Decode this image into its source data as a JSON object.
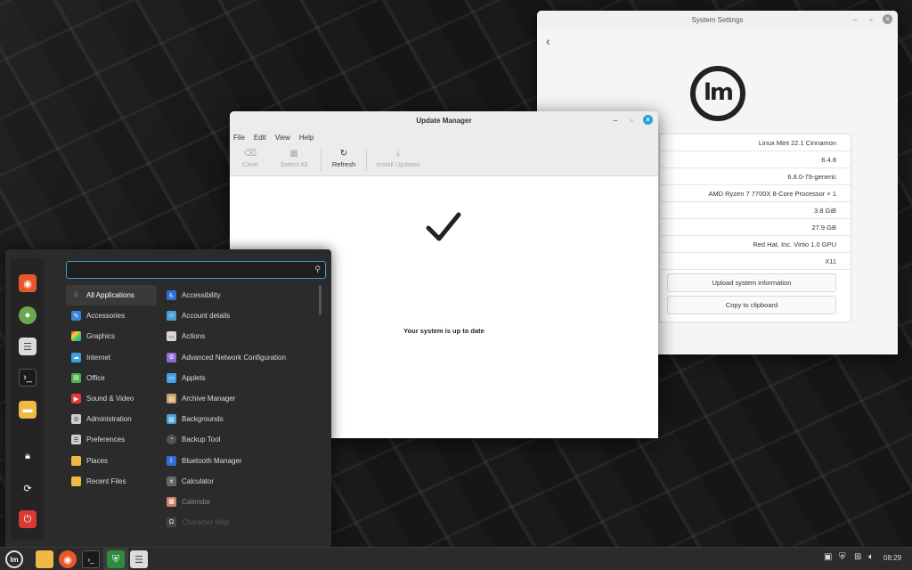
{
  "settings": {
    "title": "System Settings",
    "back_icon": "chevron-left-icon",
    "info_rows": [
      "Linux Mint 22.1 Cinnamon",
      "6.4.8",
      "6.8.0-79-generic",
      "AMD Ryzen 7 7700X 8-Core Processor × 1",
      "3.8 GiB",
      "27.9 GB",
      "Red Hat, Inc. Virtio 1.0 GPU",
      "X11"
    ],
    "upload_label": "Upload system information",
    "clipboard_label": "Copy to clipboard"
  },
  "update_manager": {
    "title": "Update Manager",
    "menu": [
      "File",
      "Edit",
      "View",
      "Help"
    ],
    "toolbar": {
      "clear": "Clear",
      "select_all": "Select All",
      "refresh": "Refresh",
      "install": "Install Updates"
    },
    "status": "Your system is up to date"
  },
  "start_menu": {
    "search_placeholder": "",
    "categories": [
      "All Applications",
      "Accessories",
      "Graphics",
      "Internet",
      "Office",
      "Sound & Video",
      "Administration",
      "Preferences",
      "Places",
      "Recent Files"
    ],
    "apps": [
      "Accessibility",
      "Account details",
      "Actions",
      "Advanced Network Configuration",
      "Applets",
      "Archive Manager",
      "Backgrounds",
      "Backup Tool",
      "Bluetooth Manager",
      "Calculator",
      "Calendar",
      "Character Map"
    ]
  },
  "taskbar": {
    "clock": "08:29"
  },
  "colors": {
    "accent": "#3da0d0",
    "mint_green": "#6aa84f",
    "firefox": "#e8572a",
    "power_red": "#d93a32"
  }
}
